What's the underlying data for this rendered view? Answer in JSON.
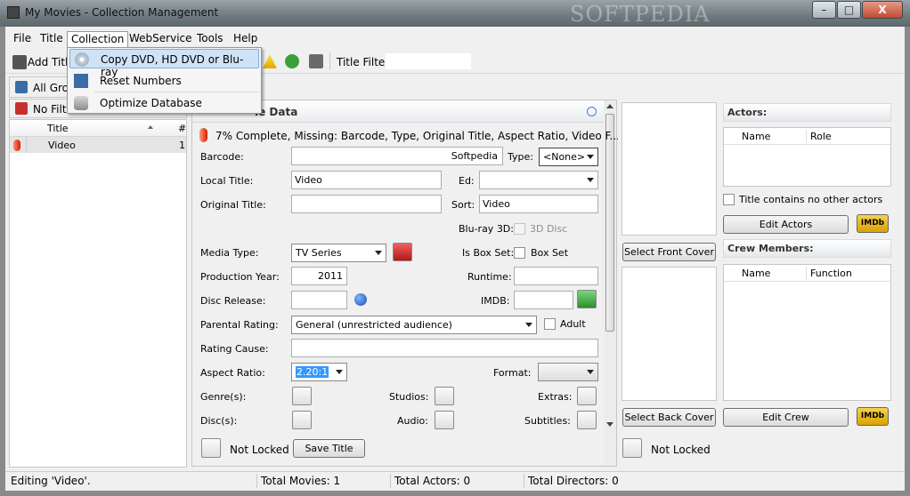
{
  "window": {
    "title": "My Movies - Collection Management",
    "watermark": "SOFTPEDIA",
    "min": "–",
    "max": "□",
    "close": "X"
  },
  "menu": {
    "items": [
      "File",
      "Title",
      "Collection",
      "WebService",
      "Tools",
      "Help"
    ]
  },
  "collection_menu": {
    "items": [
      "Copy DVD, HD DVD or Blu-ray",
      "Reset Numbers",
      "Optimize Database"
    ]
  },
  "toolbar": {
    "add_title": "Add Title",
    "title_filter_label": "Title Filter",
    "title_filter_value": ""
  },
  "left": {
    "group_button": "All Grou",
    "filter_button": "No Filte",
    "columns": [
      "Title",
      "#"
    ],
    "rows": [
      {
        "title": "Video",
        "count": "1"
      }
    ]
  },
  "editor": {
    "header": "le Data",
    "completion": "7% Complete, Missing: Barcode, Type, Original Title, Aspect Ratio, Video F...",
    "barcode_label": "Barcode:",
    "barcode_value": "Softpedia",
    "type_label": "Type:",
    "type_value": "<None>",
    "local_title_label": "Local Title:",
    "local_title_value": "Video",
    "ed_label": "Ed:",
    "ed_value": "",
    "original_title_label": "Original Title:",
    "original_title_value": "",
    "sort_label": "Sort:",
    "sort_value": "Video",
    "bluray3d_label": "Blu-ray 3D:",
    "bluray3d_option": "3D Disc",
    "media_type_label": "Media Type:",
    "media_type_value": "TV Series",
    "box_set_label": "Is Box Set:",
    "box_set_option": "Box Set",
    "production_year_label": "Production Year:",
    "production_year_value": "2011",
    "runtime_label": "Runtime:",
    "runtime_value": "",
    "disc_release_label": "Disc Release:",
    "disc_release_value": "",
    "imdb_label": "IMDB:",
    "imdb_value": "",
    "parental_rating_label": "Parental Rating:",
    "parental_rating_value": "General (unrestricted audience)",
    "adult_option": "Adult",
    "rating_cause_label": "Rating Cause:",
    "rating_cause_value": "",
    "aspect_ratio_label": "Aspect Ratio:",
    "aspect_ratio_value": "2.20:1",
    "format_label": "Format:",
    "format_value": "",
    "genres_label": "Genre(s):",
    "studios_label": "Studios:",
    "extras_label": "Extras:",
    "discs_label": "Disc(s):",
    "audio_label": "Audio:",
    "subtitles_label": "Subtitles:",
    "lock_status": "Not Locked",
    "save_button": "Save Title"
  },
  "covers": {
    "front_button": "Select Front Cover",
    "back_button": "Select Back Cover",
    "lock_status": "Not Locked"
  },
  "actors": {
    "header": "Actors:",
    "columns": [
      "Name",
      "Role"
    ],
    "no_other_actors": "Title contains no other actors",
    "edit_button": "Edit Actors",
    "imdb_badge": "IMDb"
  },
  "crew": {
    "header": "Crew Members:",
    "columns": [
      "Name",
      "Function"
    ],
    "edit_button": "Edit Crew",
    "imdb_badge": "IMDb"
  },
  "status": {
    "editing": "Editing 'Video'.",
    "total_movies": "Total Movies: 1",
    "total_actors": "Total Actors: 0",
    "total_directors": "Total Directors: 0"
  },
  "colors": {
    "accent_highlight": "#cfe3f7",
    "imdb_yellow": "#f0c020",
    "progress_red": "#e04020",
    "selection_blue": "#3399ff"
  }
}
